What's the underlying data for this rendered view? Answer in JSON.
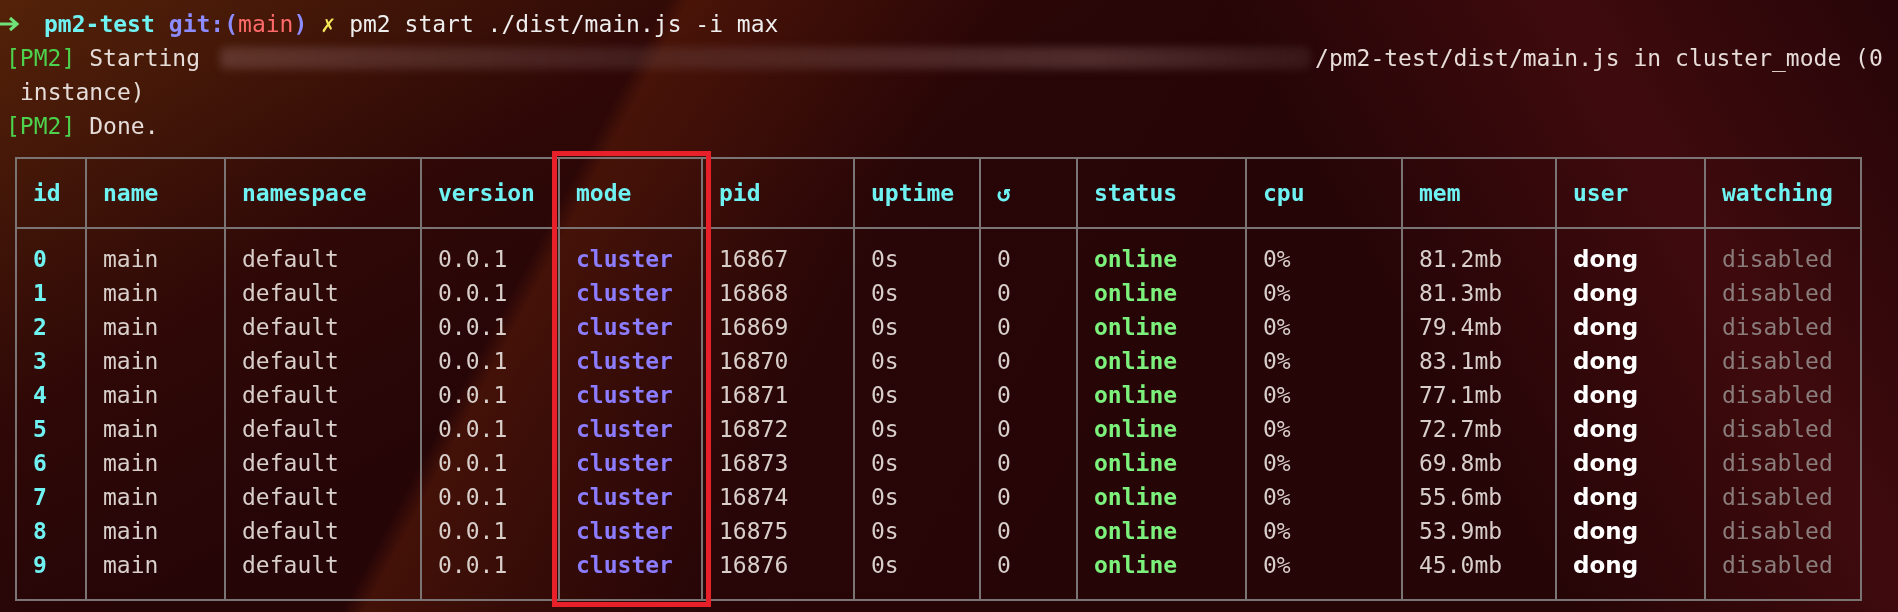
{
  "prompt": {
    "directory": "pm2-test",
    "git_prefix": "git:(",
    "branch": "main",
    "git_suffix": ")",
    "dirty_mark": "✗",
    "command": "pm2 start ./dist/main.js -i max"
  },
  "output_lines": [
    {
      "kind": "starting",
      "tag": "[PM2]",
      "text": "Starting",
      "redacted": true,
      "rest": "/pm2-test/dist/main.js in cluster_mode (0"
    },
    {
      "kind": "plain",
      "text": "instance)"
    },
    {
      "kind": "tagged",
      "tag": "[PM2]",
      "text": "Done."
    }
  ],
  "table": {
    "columns": [
      {
        "label": "id",
        "kind": "id",
        "highlighted": false
      },
      {
        "label": "name",
        "kind": "plain",
        "highlighted": false
      },
      {
        "label": "namespace",
        "kind": "plain",
        "highlighted": false
      },
      {
        "label": "version",
        "kind": "plain",
        "highlighted": false
      },
      {
        "label": "mode",
        "kind": "mode",
        "highlighted": true
      },
      {
        "label": "pid",
        "kind": "plain",
        "highlighted": false
      },
      {
        "label": "uptime",
        "kind": "plain",
        "highlighted": false
      },
      {
        "label": "↺",
        "kind": "plain",
        "highlighted": false
      },
      {
        "label": "status",
        "kind": "status",
        "highlighted": false
      },
      {
        "label": "cpu",
        "kind": "plain",
        "highlighted": false
      },
      {
        "label": "mem",
        "kind": "plain",
        "highlighted": false
      },
      {
        "label": "user",
        "kind": "user",
        "highlighted": false
      },
      {
        "label": "watching",
        "kind": "muted",
        "highlighted": false
      }
    ],
    "rows": [
      [
        "0",
        "main",
        "default",
        "0.0.1",
        "cluster",
        "16867",
        "0s",
        "0",
        "online",
        "0%",
        "81.2mb",
        "dong",
        "disabled"
      ],
      [
        "1",
        "main",
        "default",
        "0.0.1",
        "cluster",
        "16868",
        "0s",
        "0",
        "online",
        "0%",
        "81.3mb",
        "dong",
        "disabled"
      ],
      [
        "2",
        "main",
        "default",
        "0.0.1",
        "cluster",
        "16869",
        "0s",
        "0",
        "online",
        "0%",
        "79.4mb",
        "dong",
        "disabled"
      ],
      [
        "3",
        "main",
        "default",
        "0.0.1",
        "cluster",
        "16870",
        "0s",
        "0",
        "online",
        "0%",
        "83.1mb",
        "dong",
        "disabled"
      ],
      [
        "4",
        "main",
        "default",
        "0.0.1",
        "cluster",
        "16871",
        "0s",
        "0",
        "online",
        "0%",
        "77.1mb",
        "dong",
        "disabled"
      ],
      [
        "5",
        "main",
        "default",
        "0.0.1",
        "cluster",
        "16872",
        "0s",
        "0",
        "online",
        "0%",
        "72.7mb",
        "dong",
        "disabled"
      ],
      [
        "6",
        "main",
        "default",
        "0.0.1",
        "cluster",
        "16873",
        "0s",
        "0",
        "online",
        "0%",
        "69.8mb",
        "dong",
        "disabled"
      ],
      [
        "7",
        "main",
        "default",
        "0.0.1",
        "cluster",
        "16874",
        "0s",
        "0",
        "online",
        "0%",
        "55.6mb",
        "dong",
        "disabled"
      ],
      [
        "8",
        "main",
        "default",
        "0.0.1",
        "cluster",
        "16875",
        "0s",
        "0",
        "online",
        "0%",
        "53.9mb",
        "dong",
        "disabled"
      ],
      [
        "9",
        "main",
        "default",
        "0.0.1",
        "cluster",
        "16876",
        "0s",
        "0",
        "online",
        "0%",
        "45.0mb",
        "dong",
        "disabled"
      ]
    ]
  }
}
